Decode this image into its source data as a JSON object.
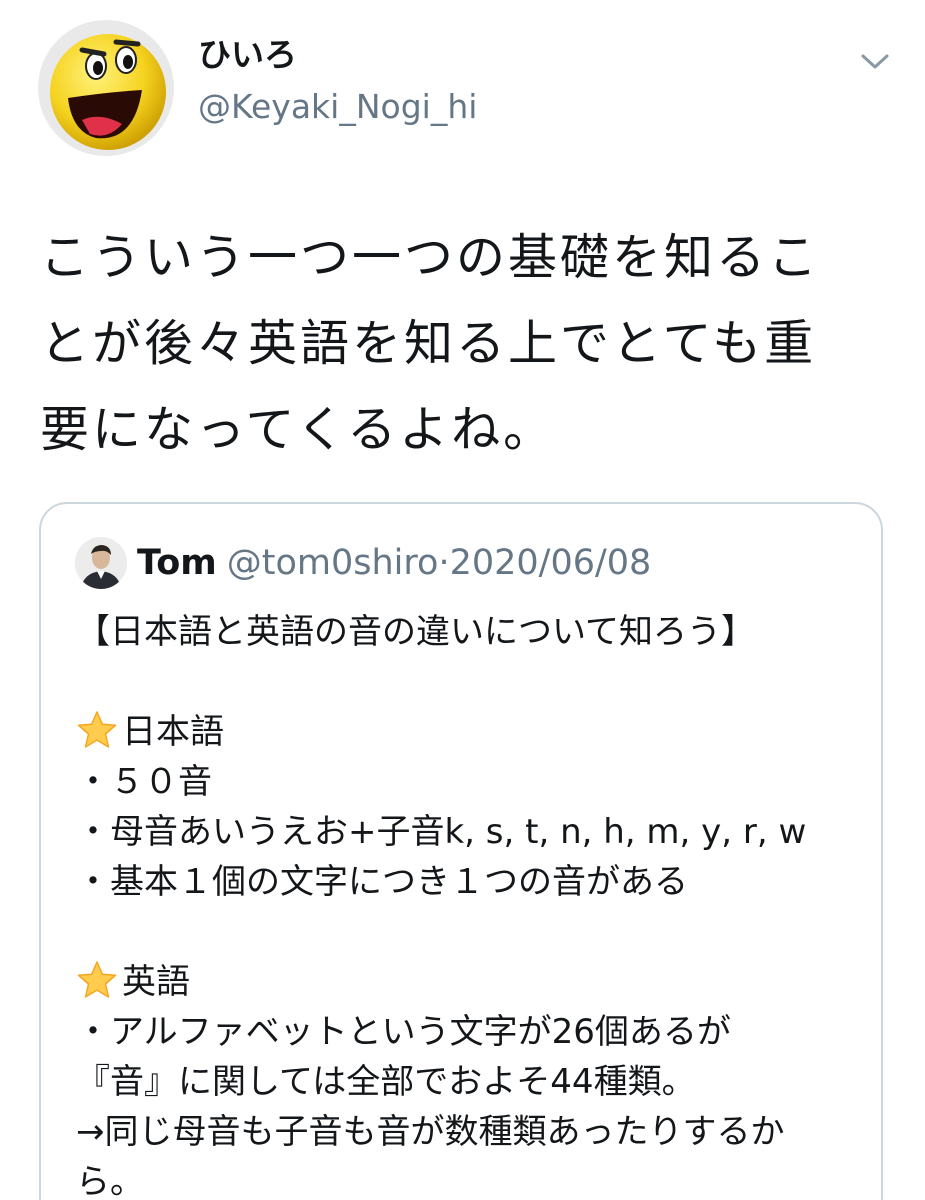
{
  "author": {
    "display_name": "ひいろ",
    "handle": "@Keyaki_Nogi_hi",
    "avatar_icon": "pacman-face-icon"
  },
  "menu": {
    "icon": "chevron-down-icon"
  },
  "tweet": {
    "lines": [
      "こういう一つ一つの基礎を知るこ",
      "とが後々英語を知る上でとても重",
      "要になってくるよね。"
    ]
  },
  "quoted_tweet": {
    "name": "Tom",
    "handle": "@tom0shiro",
    "separator": "·",
    "date": "2020/06/08",
    "avatar_icon": "person-avatar-icon",
    "heading": "【日本語と英語の音の違いについて知ろう】",
    "section1": {
      "icon": "star-icon",
      "title": "日本語",
      "items": [
        "・５０音",
        "・母音あいうえお+子音k, s, t, n, h, m, y, r, w",
        "・基本１個の文字につき１つの音がある"
      ]
    },
    "section2": {
      "icon": "star-icon",
      "title": "英語",
      "items": [
        "・アルファベットという文字が26個あるが",
        "『音』に関しては全部でおよそ44種類。",
        "→同じ母音も子音も音が数種類あったりするか",
        "ら。"
      ]
    }
  },
  "colors": {
    "text_primary": "#14171a",
    "text_secondary": "#657786",
    "border": "#ccd6dd",
    "star": "#ffcc4d",
    "avatar_yellow": "#f5d21e"
  }
}
